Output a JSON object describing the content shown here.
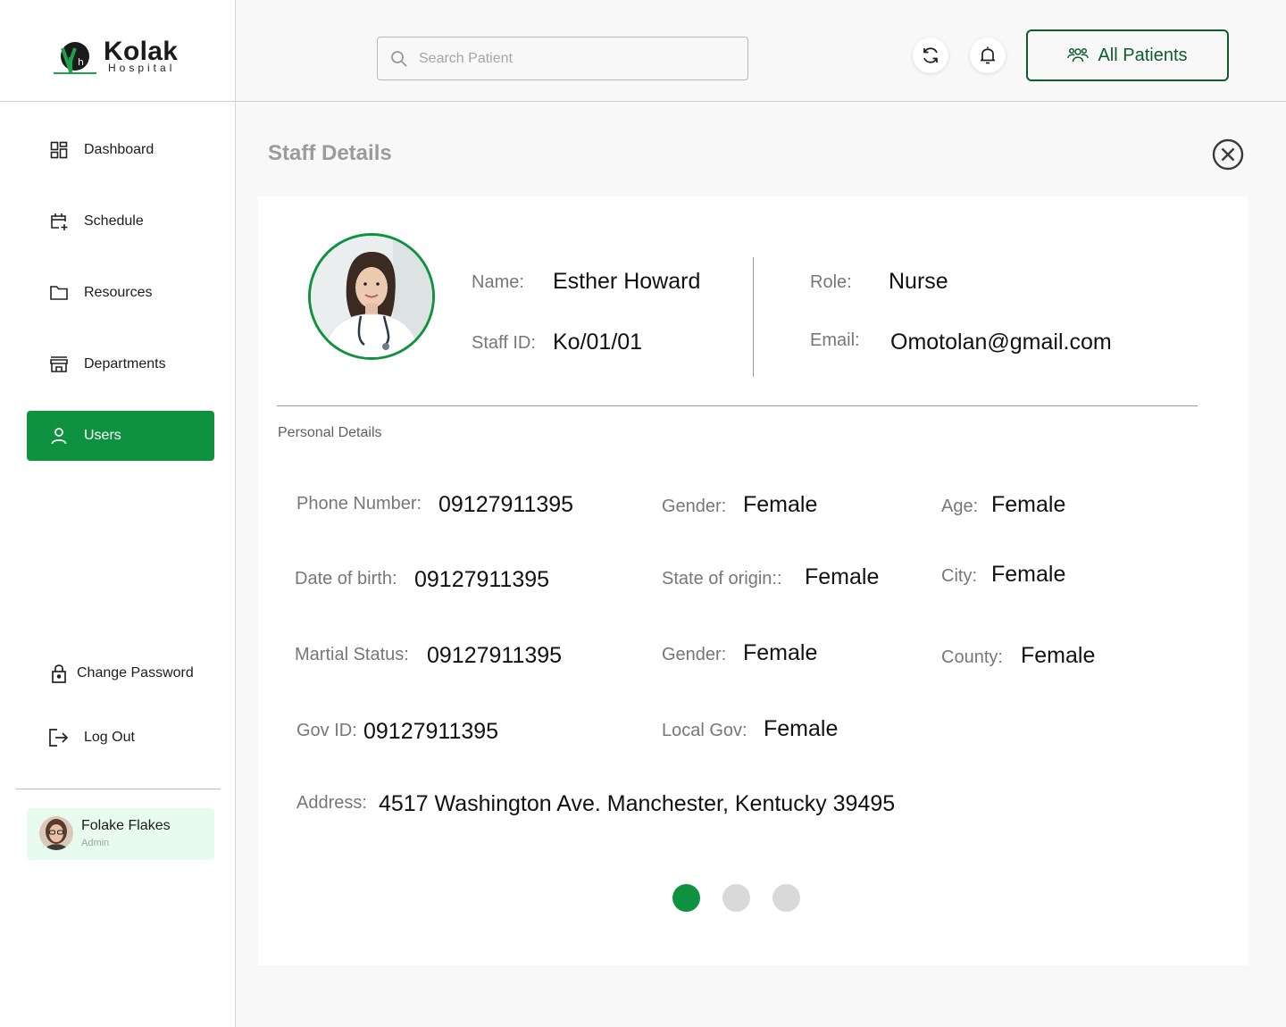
{
  "brand": {
    "name": "Kolak",
    "sub": "Hospital"
  },
  "colors": {
    "primary": "#0e9240",
    "dark_green": "#0f5c2b",
    "user_card_bg": "#e9fbee"
  },
  "sidebar": {
    "items": [
      {
        "label": "Dashboard",
        "icon": "dashboard-icon",
        "active": false
      },
      {
        "label": "Schedule",
        "icon": "calendar-add-icon",
        "active": false
      },
      {
        "label": "Resources",
        "icon": "folder-icon",
        "active": false
      },
      {
        "label": "Departments",
        "icon": "store-icon",
        "active": false
      },
      {
        "label": "Users",
        "icon": "user-icon",
        "active": true
      }
    ],
    "change_password": "Change Password",
    "logout": "Log Out",
    "user": {
      "name": "Folake Flakes",
      "role": "Admin"
    }
  },
  "topbar": {
    "search_placeholder": "Search Patient",
    "refresh_icon": "refresh-icon",
    "bell_icon": "bell-icon",
    "all_patients_label": "All Patients"
  },
  "page": {
    "title": "Staff Details"
  },
  "staff": {
    "name_label": "Name:",
    "name": "Esther Howard",
    "staff_id_label": "Staff ID:",
    "staff_id": "Ko/01/01",
    "role_label": "Role:",
    "role": "Nurse",
    "email_label": "Email:",
    "email": "Omotolan@gmail.com"
  },
  "personal": {
    "section_title": "Personal Details",
    "phone_label": "Phone Number:",
    "phone": "09127911395",
    "gender_label": "Gender:",
    "gender": "Female",
    "age_label": "Age:",
    "age": "Female",
    "dob_label": "Date of birth:",
    "dob": "09127911395",
    "state_label": "State of origin::",
    "state": "Female",
    "city_label": "City:",
    "city": "Female",
    "marital_label": "Martial Status:",
    "marital": "09127911395",
    "gender2_label": "Gender:",
    "gender2": "Female",
    "county_label": "County:",
    "county": "Female",
    "gov_id_label": "Gov ID:",
    "gov_id": "09127911395",
    "local_gov_label": "Local Gov:",
    "local_gov": "Female",
    "address_label": "Address:",
    "address": "4517 Washington Ave. Manchester, Kentucky 39495"
  },
  "pagination": {
    "pages": 3,
    "current": 1
  }
}
